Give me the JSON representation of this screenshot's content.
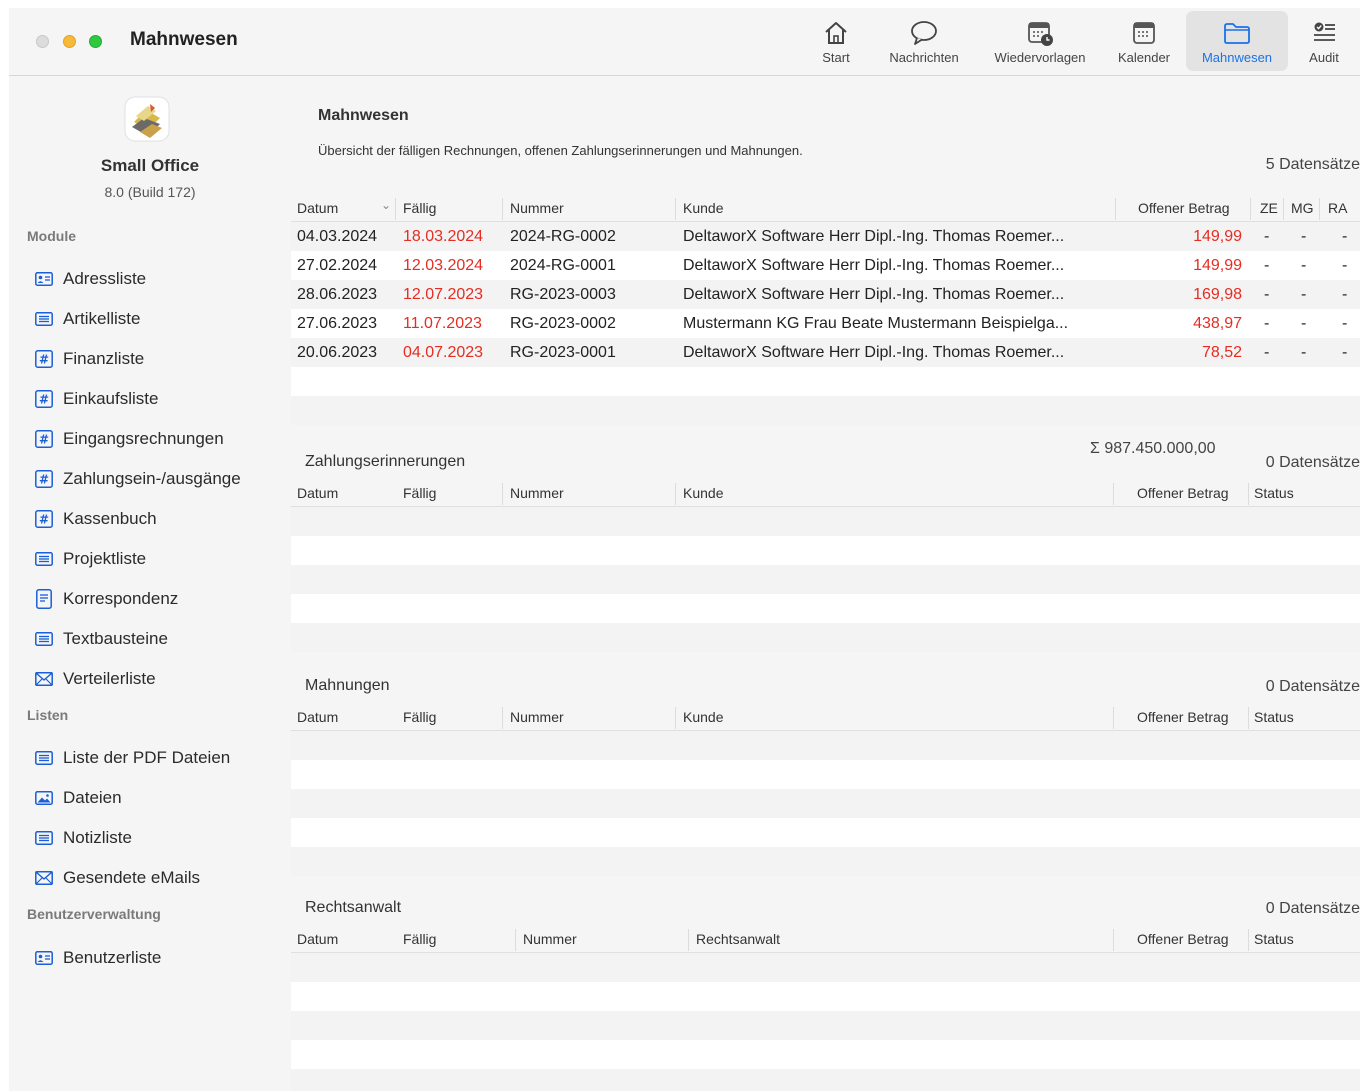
{
  "window": {
    "title": "Mahnwesen"
  },
  "toolbar": {
    "items": [
      {
        "label": "Start",
        "icon": "home-icon"
      },
      {
        "label": "Nachrichten",
        "icon": "chat-bubble-icon"
      },
      {
        "label": "Wiedervorlagen",
        "icon": "calendar-clock-icon"
      },
      {
        "label": "Kalender",
        "icon": "calendar-icon"
      },
      {
        "label": "Mahnwesen",
        "icon": "folder-icon",
        "active": true
      },
      {
        "label": "Audit",
        "icon": "checklist-icon"
      }
    ],
    "active_color": "#1a73e8"
  },
  "sidebar": {
    "app_name": "Small Office",
    "app_version": "8.0 (Build 172)",
    "sections": [
      {
        "title": "Module",
        "items": [
          {
            "label": "Adressliste",
            "icon": "address-card-icon"
          },
          {
            "label": "Artikelliste",
            "icon": "list-icon"
          },
          {
            "label": "Finanzliste",
            "icon": "hash-icon"
          },
          {
            "label": "Einkaufsliste",
            "icon": "hash-icon"
          },
          {
            "label": "Eingangsrechnungen",
            "icon": "hash-icon"
          },
          {
            "label": "Zahlungsein-/ausgänge",
            "icon": "hash-icon"
          },
          {
            "label": "Kassenbuch",
            "icon": "hash-icon"
          },
          {
            "label": "Projektliste",
            "icon": "list-icon"
          },
          {
            "label": "Korrespondenz",
            "icon": "document-icon"
          },
          {
            "label": "Textbausteine",
            "icon": "list-icon"
          },
          {
            "label": "Verteilerliste",
            "icon": "envelope-icon"
          }
        ]
      },
      {
        "title": "Listen",
        "items": [
          {
            "label": "Liste der PDF Dateien",
            "icon": "list-icon"
          },
          {
            "label": "Dateien",
            "icon": "image-icon"
          },
          {
            "label": "Notizliste",
            "icon": "list-icon"
          },
          {
            "label": "Gesendete eMails",
            "icon": "envelope-icon"
          }
        ]
      },
      {
        "title": "Benutzerverwaltung",
        "items": [
          {
            "label": "Benutzerliste",
            "icon": "address-card-icon"
          }
        ]
      }
    ]
  },
  "main": {
    "title": "Mahnwesen",
    "subtitle": "Übersicht der fälligen Rechnungen, offenen Zahlungserinnerungen und Mahnungen.",
    "invoices": {
      "count": "5 Datensätze",
      "columns": [
        "Datum",
        "Fällig",
        "Nummer",
        "Kunde",
        "Offener Betrag",
        "ZE",
        "MG",
        "RA"
      ],
      "rows": [
        {
          "datum": "04.03.2024",
          "faellig": "18.03.2024",
          "nummer": "2024-RG-0002",
          "kunde": "DeltaworX Software Herr Dipl.-Ing. Thomas Roemer...",
          "betrag": "149,99",
          "ze": "-",
          "mg": "-",
          "ra": "-"
        },
        {
          "datum": "27.02.2024",
          "faellig": "12.03.2024",
          "nummer": "2024-RG-0001",
          "kunde": "DeltaworX Software Herr Dipl.-Ing. Thomas Roemer...",
          "betrag": "149,99",
          "ze": "-",
          "mg": "-",
          "ra": "-"
        },
        {
          "datum": "28.06.2023",
          "faellig": "12.07.2023",
          "nummer": "RG-2023-0003",
          "kunde": "DeltaworX Software Herr Dipl.-Ing. Thomas Roemer...",
          "betrag": "169,98",
          "ze": "-",
          "mg": "-",
          "ra": "-"
        },
        {
          "datum": "27.06.2023",
          "faellig": "11.07.2023",
          "nummer": "RG-2023-0002",
          "kunde": "Mustermann KG Frau Beate Mustermann Beispielga...",
          "betrag": "438,97",
          "ze": "-",
          "mg": "-",
          "ra": "-"
        },
        {
          "datum": "20.06.2023",
          "faellig": "04.07.2023",
          "nummer": "RG-2023-0001",
          "kunde": "DeltaworX Software Herr Dipl.-Ing. Thomas Roemer...",
          "betrag": "78,52",
          "ze": "-",
          "mg": "-",
          "ra": "-"
        }
      ],
      "sum": "Σ 987.450.000,00"
    },
    "reminders": {
      "title": "Zahlungserinnerungen",
      "count": "0 Datensätze",
      "columns": [
        "Datum",
        "Fällig",
        "Nummer",
        "Kunde",
        "Offener Betrag",
        "Status"
      ]
    },
    "dunning": {
      "title": "Mahnungen",
      "count": "0 Datensätze",
      "columns": [
        "Datum",
        "Fällig",
        "Nummer",
        "Kunde",
        "Offener Betrag",
        "Status"
      ]
    },
    "lawyer": {
      "title": "Rechtsanwalt",
      "count": "0 Datensätze",
      "columns": [
        "Datum",
        "Fällig",
        "Nummer",
        "Rechtsanwalt",
        "Offener Betrag",
        "Status"
      ]
    }
  },
  "colors": {
    "overdue": "#e52d22",
    "accent": "#1a73e8"
  }
}
